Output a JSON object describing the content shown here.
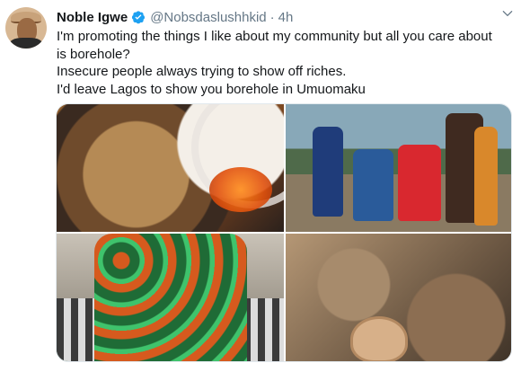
{
  "tweet": {
    "display_name": "Noble Igwe",
    "handle": "@Nobsdaslushhkid",
    "separator": "·",
    "timestamp": "4h",
    "text_lines": [
      "I'm promoting the things I like about my community but all you care about",
      "is borehole?",
      "Insecure people always trying to show off riches.",
      "I'd leave Lagos to show you borehole in Umuomaku"
    ],
    "media_count": 4
  },
  "colors": {
    "text": "#14171a",
    "muted": "#657786",
    "verified": "#1da1f2",
    "border": "#e1e8ed"
  }
}
